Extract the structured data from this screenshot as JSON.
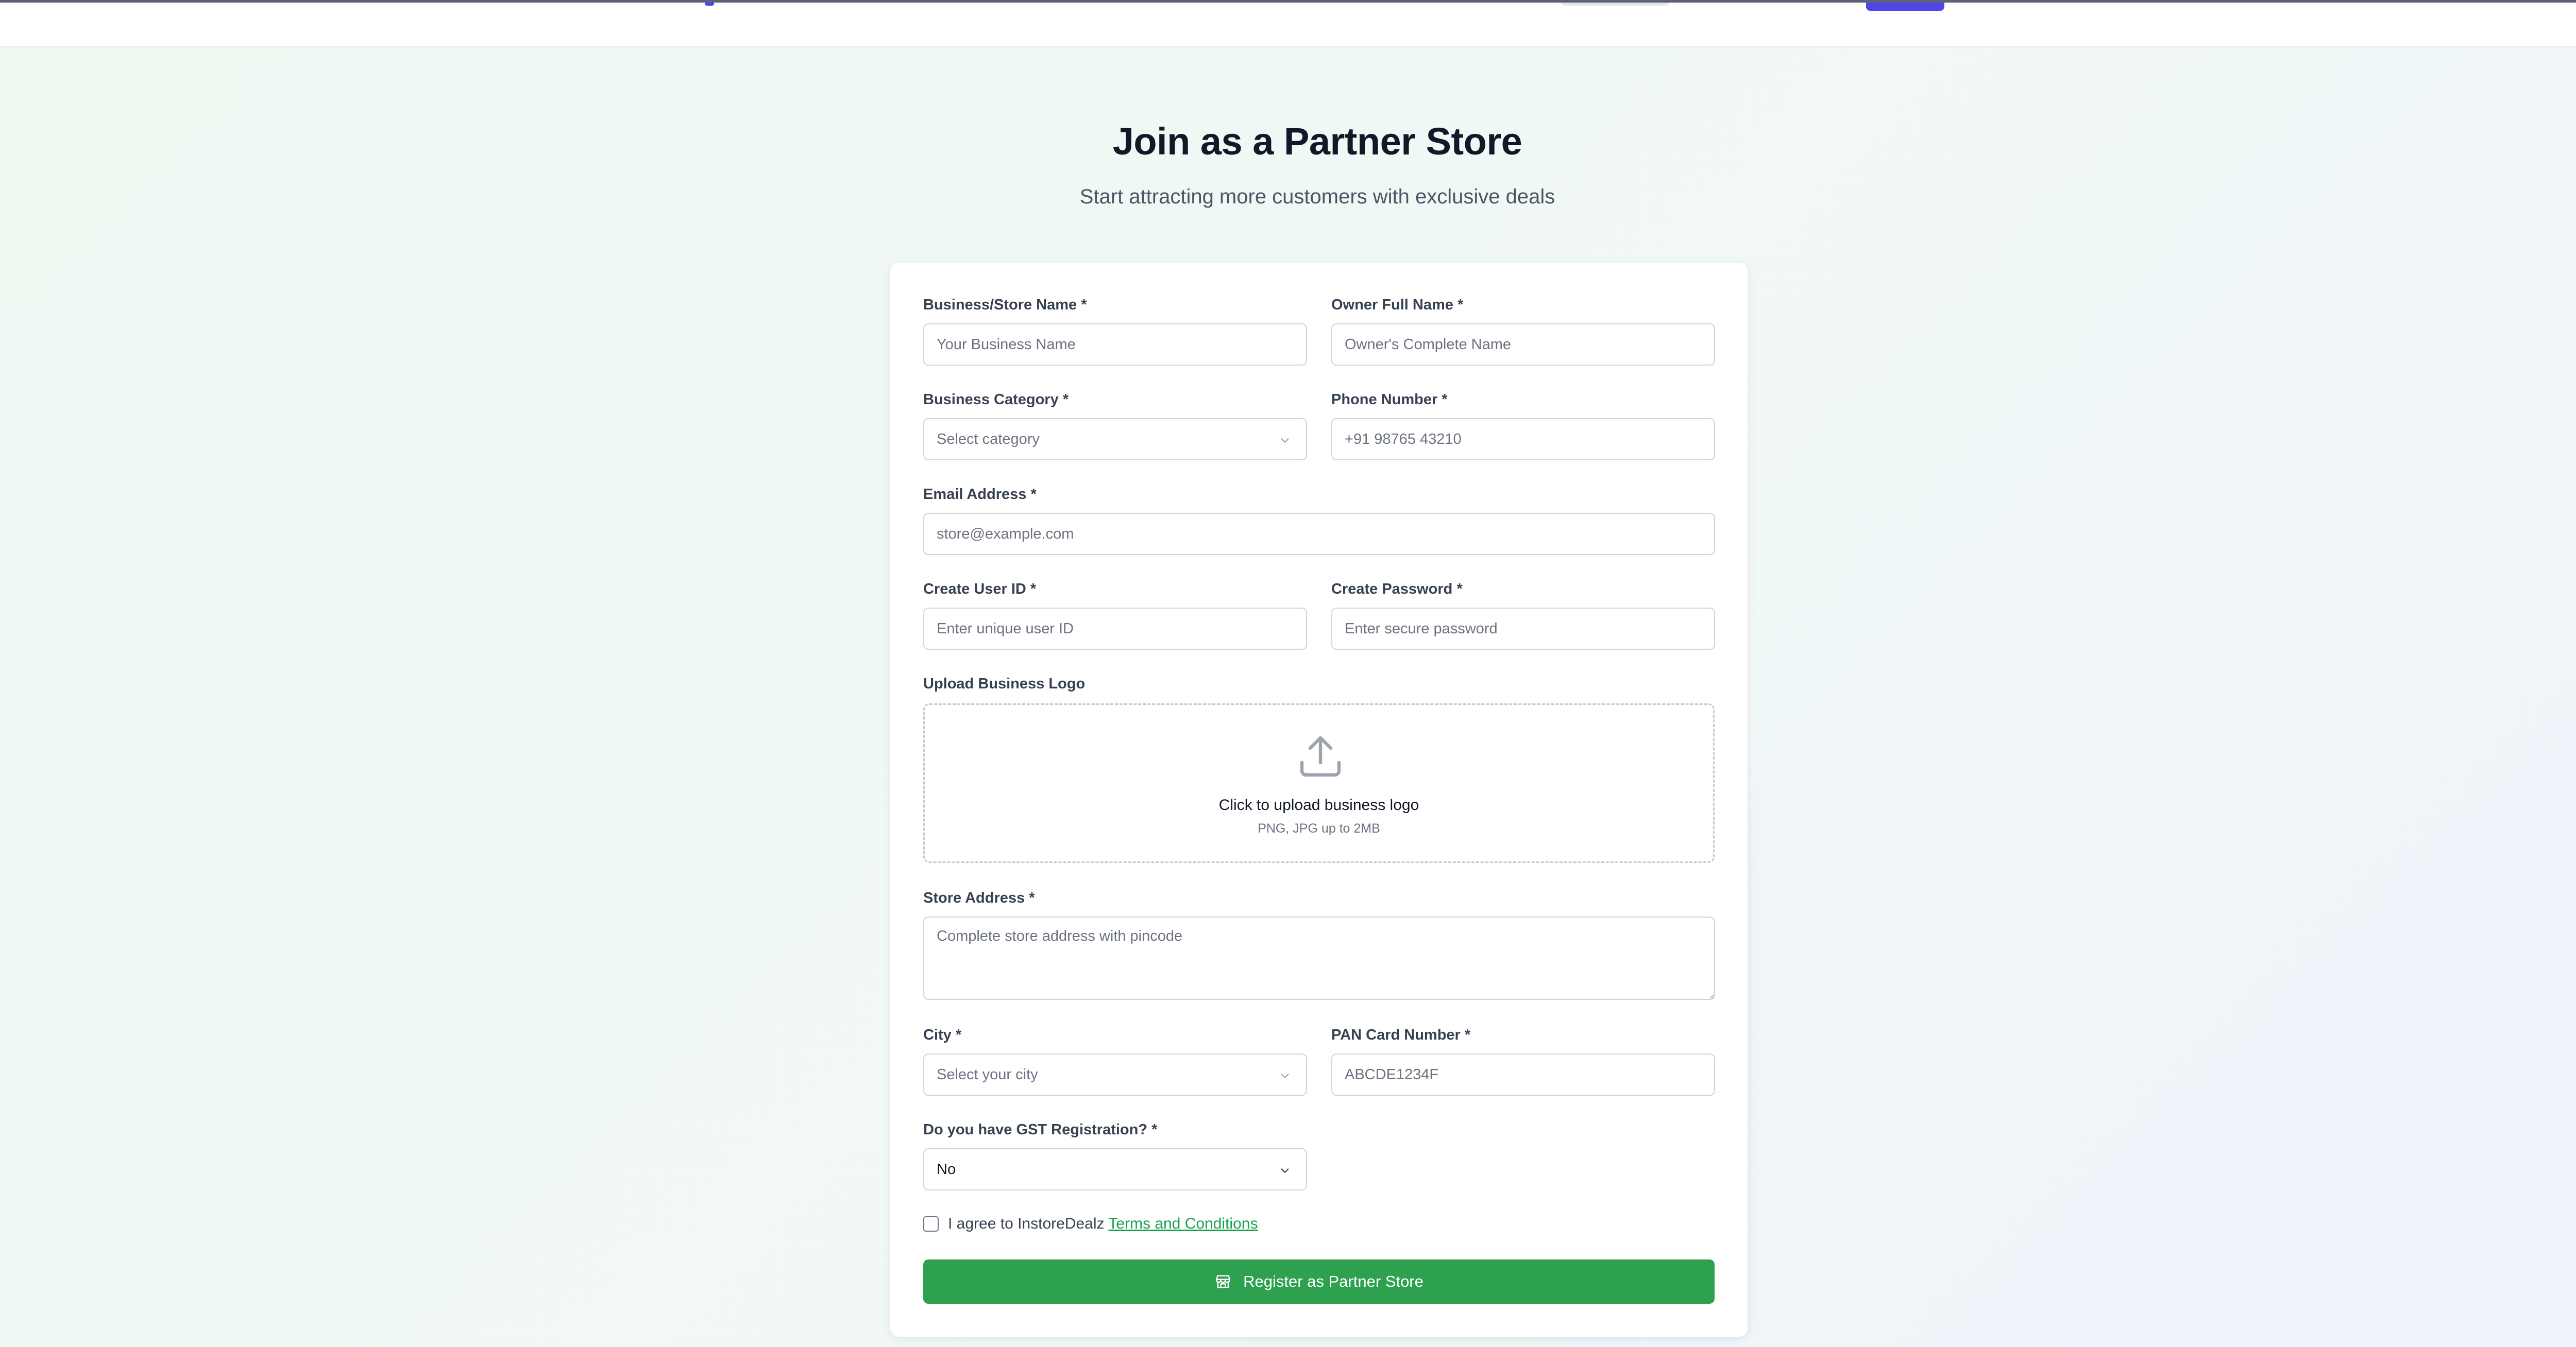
{
  "page": {
    "title": "Join as a Partner Store",
    "subtitle": "Start attracting more customers with exclusive deals"
  },
  "form": {
    "business_name": {
      "label": "Business/Store Name *",
      "placeholder": "Your Business Name"
    },
    "owner_name": {
      "label": "Owner Full Name *",
      "placeholder": "Owner's Complete Name"
    },
    "category": {
      "label": "Business Category *",
      "value": "Select category"
    },
    "phone": {
      "label": "Phone Number *",
      "placeholder": "+91 98765 43210"
    },
    "email": {
      "label": "Email Address *",
      "placeholder": "store@example.com"
    },
    "user_id": {
      "label": "Create User ID *",
      "placeholder": "Enter unique user ID"
    },
    "password": {
      "label": "Create Password *",
      "placeholder": "Enter secure password"
    },
    "logo": {
      "label": "Upload Business Logo",
      "title": "Click to upload business logo",
      "hint": "PNG, JPG up to 2MB",
      "icon": "upload-icon"
    },
    "address": {
      "label": "Store Address *",
      "placeholder": "Complete store address with pincode"
    },
    "city": {
      "label": "City *",
      "value": "Select your city"
    },
    "pan": {
      "label": "PAN Card Number *",
      "placeholder": "ABCDE1234F"
    },
    "gst": {
      "label": "Do you have GST Registration? *",
      "value": "No"
    },
    "terms": {
      "prefix": "I agree to InstoreDealz",
      "link": "Terms and Conditions"
    },
    "submit": {
      "label": "Register as Partner Store",
      "icon": "store-icon"
    }
  },
  "colors": {
    "accent_green": "#2ea14f",
    "link_green": "#16a34a",
    "nav_accent": "#5046e5"
  }
}
